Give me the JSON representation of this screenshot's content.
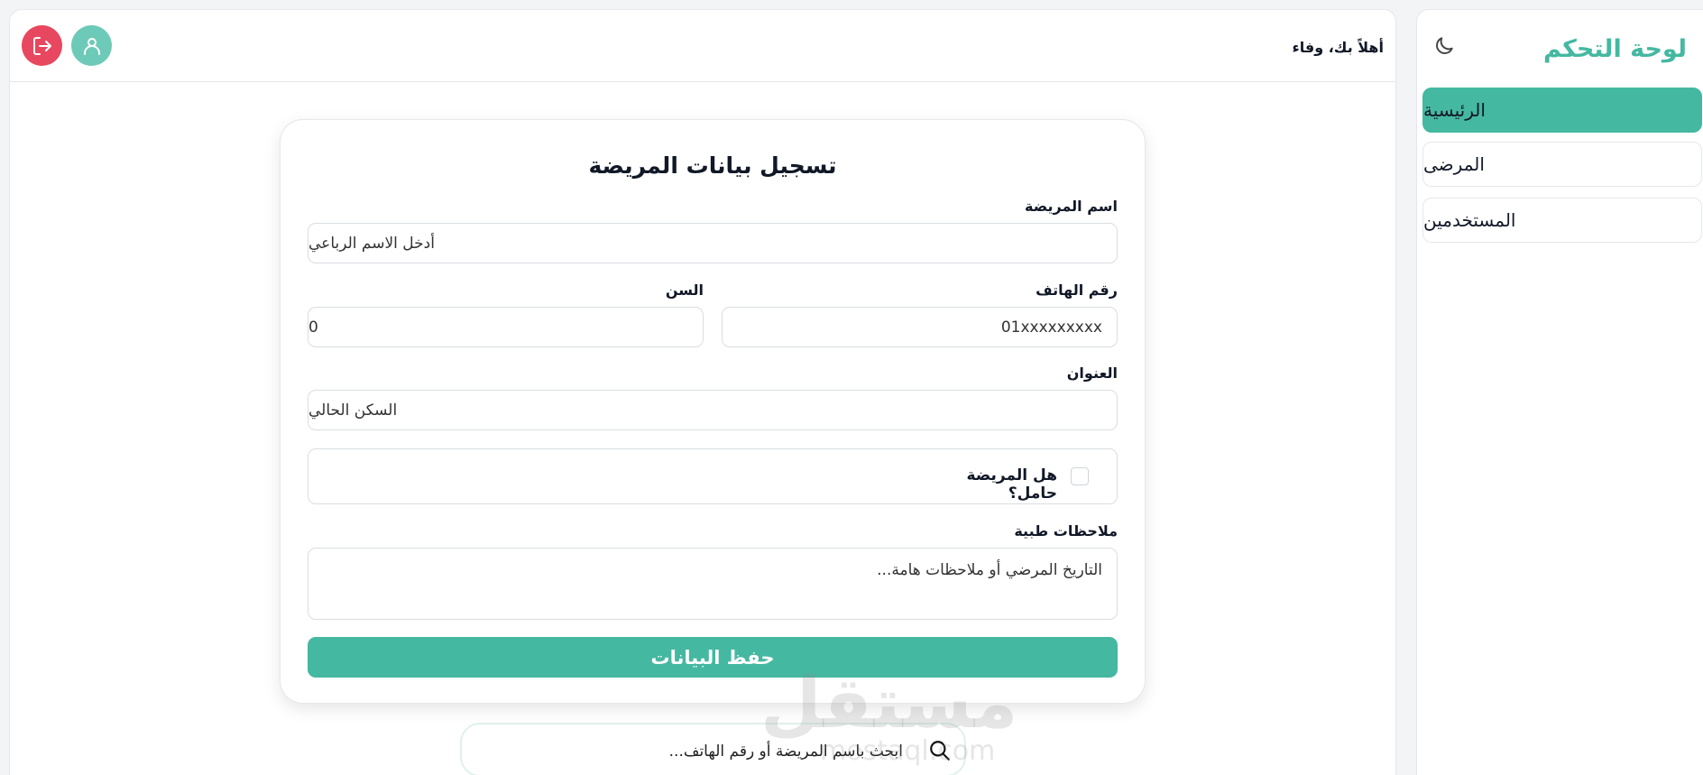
{
  "sidebar": {
    "title": "لوحة التحكم",
    "items": [
      {
        "label": "الرئيسية",
        "active": true
      },
      {
        "label": "المرضى",
        "active": false
      },
      {
        "label": "المستخدمين",
        "active": false
      }
    ]
  },
  "header": {
    "greeting": "أهلاً بك، وفاء"
  },
  "form": {
    "title": "تسجيل بيانات المريضة",
    "name_label": "اسم المريضة",
    "name_placeholder": "أدخل الاسم الرباعي",
    "phone_label": "رقم الهاتف",
    "phone_placeholder": "01xxxxxxxxx",
    "age_label": "السن",
    "age_value": "0",
    "address_label": "العنوان",
    "address_placeholder": "السكن الحالي",
    "pregnant_label": "هل المريضة حامل؟",
    "notes_label": "ملاحظات طبية",
    "notes_placeholder": "التاريخ المرضي أو ملاحظات هامة...",
    "save_label": "حفظ البيانات"
  },
  "search": {
    "placeholder": "ابحث باسم المريضة أو رقم الهاتف..."
  },
  "watermark": {
    "text": "مستقل",
    "sub": "mostaql.com"
  },
  "colors": {
    "accent": "#45b8a1",
    "danger": "#e8485f",
    "user_button": "#6ecab8"
  }
}
